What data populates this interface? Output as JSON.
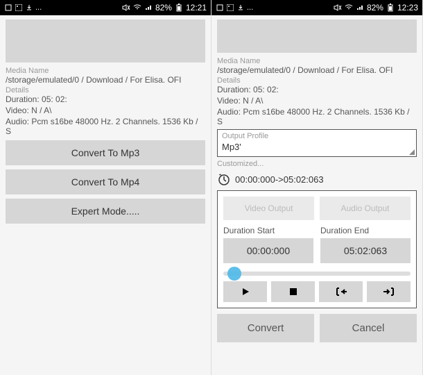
{
  "left": {
    "status": {
      "battery": "82%",
      "time": "12:21"
    },
    "media_name_label": "Media Name",
    "media_name": "/storage/emulated/0 / Download / For Elisa. OFI",
    "details_label": "Details",
    "duration": "Duration: 05: 02:",
    "video": "Video: N / A\\",
    "audio": "Audio: Pcm s16be 48000 Hz. 2 Channels. 1536 Kb / S",
    "btn_mp3": "Convert To Mp3",
    "btn_mp4": "Convert To Mp4",
    "btn_expert": "Expert Mode....."
  },
  "right": {
    "status": {
      "battery": "82%",
      "time": "12:23"
    },
    "media_name_label": "Media Name",
    "media_name": "/storage/emulated/0 / Download / For Elisa. OFI",
    "details_label": "Details",
    "duration": "Duration: 05: 02:",
    "video": "Video: N / A\\",
    "audio": "Audio: Pcm s16be 48000 Hz. 2 Channels. 1536 Kb / S",
    "profile_label": "Output Profile",
    "profile_value": "Mp3'",
    "customized_label": "Customized...",
    "time_range": "00:00:000->05:02:063",
    "tab_video": "Video Output",
    "tab_audio": "Audio Output",
    "dur_start_label": "Duration Start",
    "dur_start_value": "00:00:000",
    "dur_end_label": "Duration End",
    "dur_end_value": "05:02:063",
    "convert": "Convert",
    "cancel": "Cancel"
  }
}
